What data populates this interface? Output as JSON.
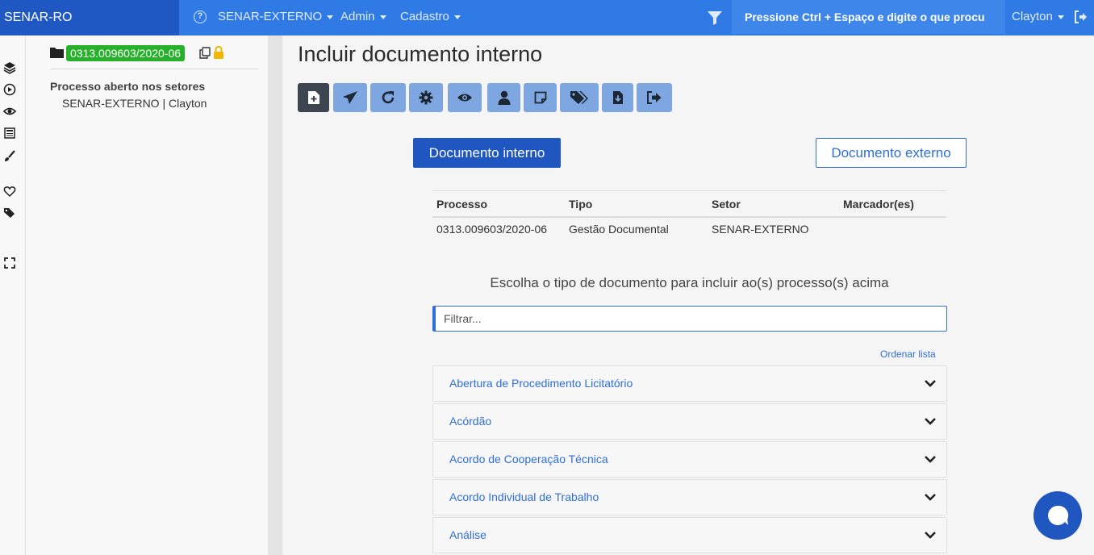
{
  "header": {
    "brand": "SENAR-RO",
    "nav": [
      "SENAR-EXTERNO",
      "Admin",
      "Cadastro"
    ],
    "search": "Pressione Ctrl + Espaço e digite o que procu",
    "user": "Clayton",
    "help_icon": "?"
  },
  "sidebar_icons": [
    "layers-icon",
    "play-circle-icon",
    "eye-icon",
    "newspaper-icon",
    "paintbrush-icon",
    "heart-icon",
    "tags-icon",
    "expand-icon"
  ],
  "left_panel": {
    "process_number": "0313.009603/2020-06",
    "sectors_title": "Processo aberto nos setores",
    "sector": "SENAR-EXTERNO | Clayton"
  },
  "main": {
    "title": "Incluir documento interno",
    "toolbar": [
      "new-document-icon",
      "send-icon",
      "refresh-icon",
      "settings-icon",
      "view-icon",
      "user-icon",
      "note-icon",
      "tags-icon",
      "download-file-icon",
      "exit-icon"
    ],
    "btn_internal": "Documento interno",
    "btn_external": "Documento externo",
    "table": {
      "headers": [
        "Processo",
        "Tipo",
        "Setor",
        "Marcador(es)"
      ],
      "row": [
        "0313.009603/2020-06",
        "Gestão Documental",
        "SENAR-EXTERNO",
        ""
      ]
    },
    "choose_label": "Escolha o tipo de documento para incluir ao(s) processo(s) acima",
    "filter_placeholder": "Filtrar...",
    "sort_link": "Ordenar lista",
    "doc_types": [
      "Abertura de Procedimento Licitatório",
      "Acórdão",
      "Acordo de Cooperação Técnica",
      "Acordo Individual de Trabalho",
      "Análise"
    ]
  },
  "colors": {
    "navbar": "#2f7ae5",
    "brand": "#1f56c0",
    "badge": "#27b02a",
    "toolbar_button": "#7ea7e2",
    "link": "#2f6fd7"
  }
}
